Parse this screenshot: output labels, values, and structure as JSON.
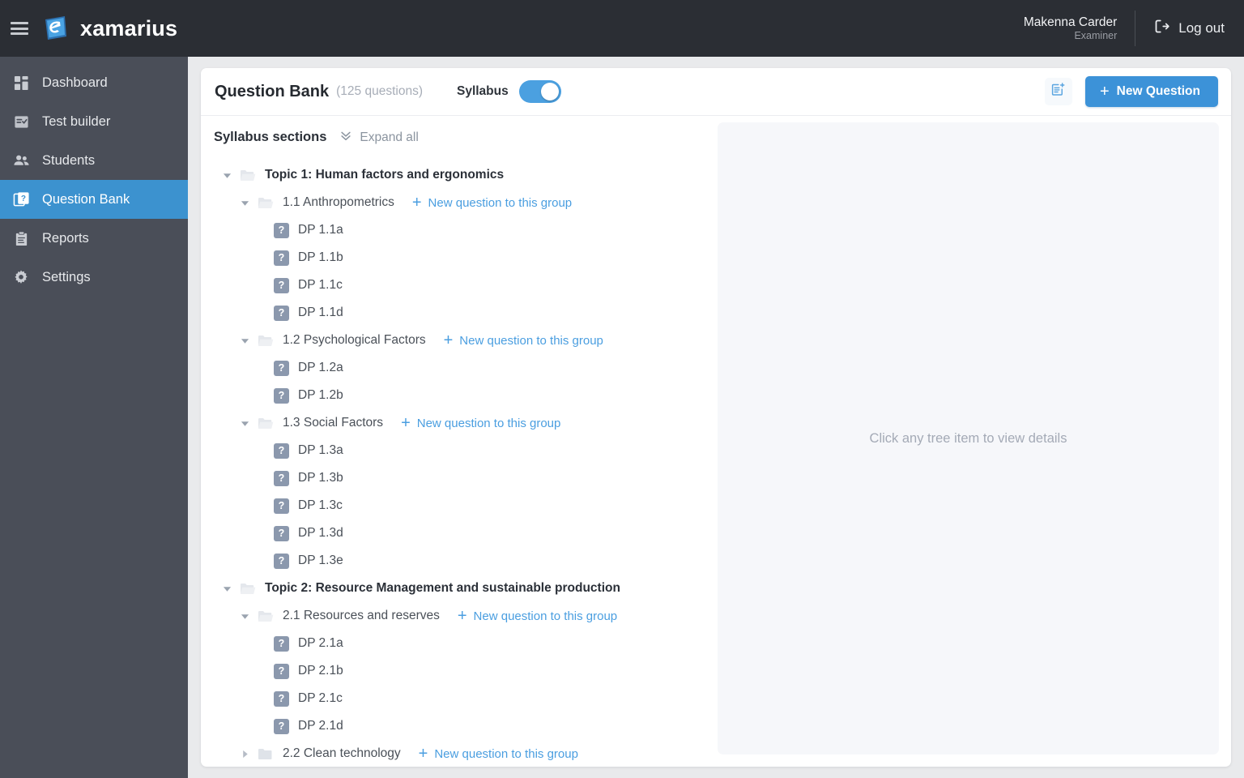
{
  "topbar": {
    "menu_icon": "hamburger-icon",
    "logo_text": "xamarius",
    "user_name": "Makenna Carder",
    "user_role": "Examiner",
    "logout_label": "Log out",
    "logout_icon": "logout-icon"
  },
  "sidebar": {
    "items": [
      {
        "label": "Dashboard",
        "icon": "dashboard-icon",
        "active": false
      },
      {
        "label": "Test builder",
        "icon": "test-builder-icon",
        "active": false
      },
      {
        "label": "Students",
        "icon": "students-icon",
        "active": false
      },
      {
        "label": "Question Bank",
        "icon": "question-bank-icon",
        "active": true
      },
      {
        "label": "Reports",
        "icon": "reports-icon",
        "active": false
      },
      {
        "label": "Settings",
        "icon": "settings-gear-icon",
        "active": false
      }
    ]
  },
  "header": {
    "title": "Question Bank",
    "count": "(125 questions)",
    "toggle_label": "Syllabus",
    "toggle_on": true,
    "import_icon": "new-note-icon",
    "new_question_label": "New Question",
    "new_question_plus": "+",
    "accent_blue": "#3c92d8",
    "toggle_blue": "#4ba0e0"
  },
  "tree": {
    "heading": "Syllabus sections",
    "expand_all_label": "Expand all",
    "expand_all_icon": "double-chevron-down-icon",
    "add_link_label": "New question to this group",
    "nodes": [
      {
        "level": 1,
        "type": "topic",
        "label": "Topic 1: Human factors and ergonomics",
        "expanded": true,
        "add": false
      },
      {
        "level": 2,
        "type": "group",
        "label": "1.1 Anthropometrics",
        "expanded": true,
        "add": true
      },
      {
        "level": 3,
        "type": "question",
        "label": "DP 1.1a"
      },
      {
        "level": 3,
        "type": "question",
        "label": "DP 1.1b"
      },
      {
        "level": 3,
        "type": "question",
        "label": "DP 1.1c"
      },
      {
        "level": 3,
        "type": "question",
        "label": "DP 1.1d"
      },
      {
        "level": 2,
        "type": "group",
        "label": "1.2 Psychological Factors",
        "expanded": true,
        "add": true
      },
      {
        "level": 3,
        "type": "question",
        "label": "DP 1.2a"
      },
      {
        "level": 3,
        "type": "question",
        "label": "DP 1.2b"
      },
      {
        "level": 2,
        "type": "group",
        "label": "1.3 Social Factors",
        "expanded": true,
        "add": true
      },
      {
        "level": 3,
        "type": "question",
        "label": "DP 1.3a"
      },
      {
        "level": 3,
        "type": "question",
        "label": "DP 1.3b"
      },
      {
        "level": 3,
        "type": "question",
        "label": "DP 1.3c"
      },
      {
        "level": 3,
        "type": "question",
        "label": "DP 1.3d"
      },
      {
        "level": 3,
        "type": "question",
        "label": "DP 1.3e"
      },
      {
        "level": 1,
        "type": "topic",
        "label": "Topic 2: Resource Management and sustainable production",
        "expanded": true,
        "add": false
      },
      {
        "level": 2,
        "type": "group",
        "label": "2.1 Resources and reserves",
        "expanded": true,
        "add": true
      },
      {
        "level": 3,
        "type": "question",
        "label": "DP 2.1a"
      },
      {
        "level": 3,
        "type": "question",
        "label": "DP 2.1b"
      },
      {
        "level": 3,
        "type": "question",
        "label": "DP 2.1c"
      },
      {
        "level": 3,
        "type": "question",
        "label": "DP 2.1d"
      },
      {
        "level": 2,
        "type": "group",
        "label": "2.2 Clean technology",
        "expanded": false,
        "add": true
      }
    ]
  },
  "detail": {
    "empty_text": "Click any tree item to view details"
  }
}
